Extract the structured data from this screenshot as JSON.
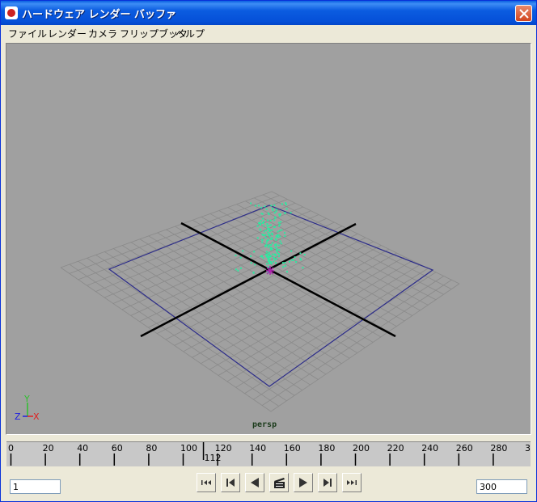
{
  "window": {
    "title": "ハードウェア レンダー バッファ"
  },
  "menu": [
    "ファイル",
    "レンダー",
    "カメラ",
    "フリップブック",
    "ヘルプ"
  ],
  "viewport": {
    "camera_label": "persp",
    "axis_labels": {
      "x": "X",
      "y": "Y",
      "z": "Z"
    }
  },
  "timeline": {
    "ticks": [
      "0",
      "20",
      "40",
      "60",
      "80",
      "100",
      "120",
      "140",
      "160",
      "180",
      "200",
      "220",
      "240",
      "260",
      "280",
      "3"
    ],
    "current_frame": "112"
  },
  "playback": {
    "start_frame": "1",
    "end_frame": "300",
    "buttons": [
      "go-to-start",
      "step-back",
      "play-backward",
      "clapper",
      "play-forward",
      "step-forward",
      "go-to-end"
    ]
  },
  "colors": {
    "viewport_bg": "#a0a0a0",
    "particles": "#2ee8a0",
    "title_bar": "#0a5fe0"
  }
}
